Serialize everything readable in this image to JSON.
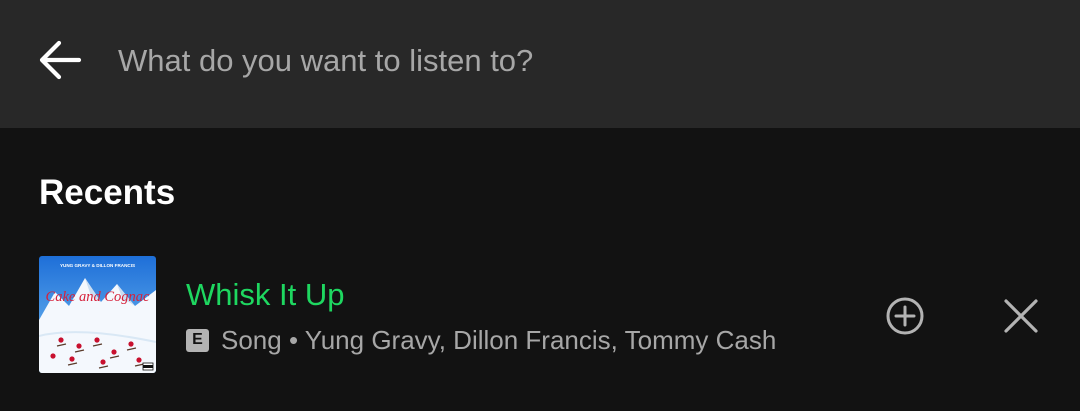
{
  "search": {
    "placeholder": "What do you want to listen to?",
    "value": ""
  },
  "recents": {
    "title": "Recents",
    "items": [
      {
        "title": "Whisk It Up",
        "explicit_badge": "E",
        "meta": "Song • Yung Gravy, Dillon Francis, Tommy Cash",
        "cover": {
          "top_text": "YUNG GRAVY & DILLON FRANCIS",
          "script_text": "Cake and Cognac"
        }
      }
    ]
  },
  "colors": {
    "background": "#121212",
    "search_bar": "#282828",
    "accent_green": "#1ed760",
    "secondary_text": "#a7a7a7",
    "icon": "#b3b3b3"
  },
  "icons": {
    "back": "arrow-left-icon",
    "add": "plus-circle-icon",
    "remove": "close-icon"
  }
}
